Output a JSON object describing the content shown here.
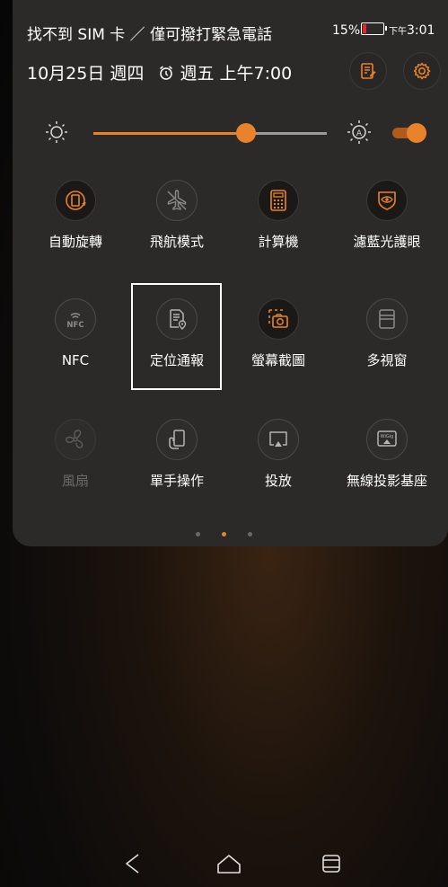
{
  "status": {
    "carrier": "找不到 SIM 卡 ／ 僅可撥打緊急電話",
    "battery_percent": "15%",
    "battery_level": 0.15,
    "time_ampm": "下午",
    "time": "3:01"
  },
  "header": {
    "date": "10月25日 週四",
    "alarm": "週五 上午7:00"
  },
  "brightness": {
    "level": 0.68,
    "auto_enabled": true
  },
  "tiles": [
    {
      "label": "自動旋轉",
      "icon": "auto-rotate-icon",
      "state": "on"
    },
    {
      "label": "飛航模式",
      "icon": "airplane-icon",
      "state": "off"
    },
    {
      "label": "計算機",
      "icon": "calculator-icon",
      "state": "on"
    },
    {
      "label": "濾藍光護眼",
      "icon": "eye-shield-icon",
      "state": "on"
    },
    {
      "label": "NFC",
      "icon": "nfc-icon",
      "state": "off"
    },
    {
      "label": "定位通報",
      "icon": "location-report-icon",
      "state": "off"
    },
    {
      "label": "螢幕截圖",
      "icon": "screenshot-icon",
      "state": "on"
    },
    {
      "label": "多視窗",
      "icon": "multi-window-icon",
      "state": "off"
    },
    {
      "label": "風扇",
      "icon": "fan-icon",
      "state": "disabled"
    },
    {
      "label": "單手操作",
      "icon": "one-hand-icon",
      "state": "off"
    },
    {
      "label": "投放",
      "icon": "cast-icon",
      "state": "off"
    },
    {
      "label": "無線投影基座",
      "icon": "wigig-dock-icon",
      "state": "off"
    }
  ],
  "pager": {
    "count": 3,
    "active": 2
  },
  "colors": {
    "accent": "#e8832b",
    "panel": "#2b2a28",
    "battery_low": "#e8232b"
  }
}
